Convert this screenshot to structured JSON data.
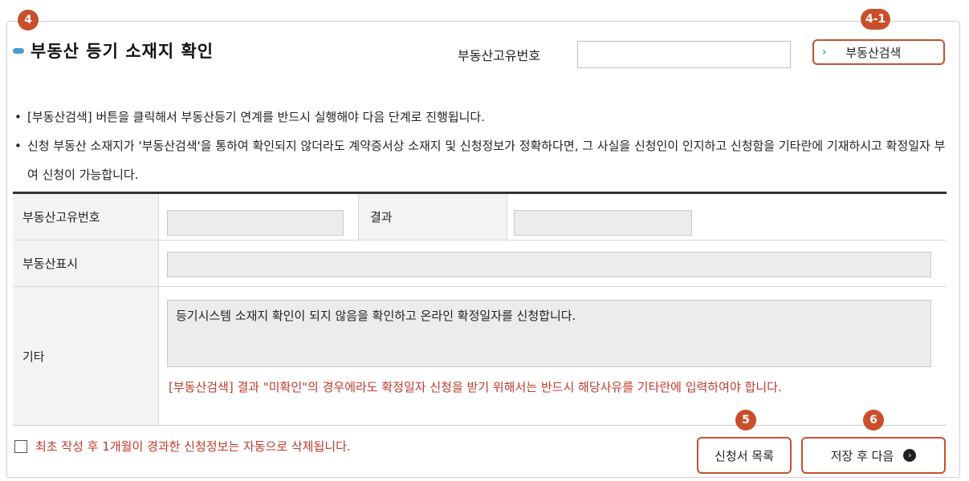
{
  "badges": {
    "step4": "4",
    "step4_1": "4-1",
    "step5": "5",
    "step6": "6"
  },
  "header": {
    "title": "부동산 등기 소재지 확인",
    "unique_no_label": "부동산고유번호",
    "unique_no_value": "",
    "search_button": "부동산검색",
    "search_chevron": "›"
  },
  "notes": [
    {
      "bullet": "•",
      "text": "[부동산검색] 버튼을 클릭해서 부동산등기 연계를 반드시 실행해야 다음 단계로 진행됩니다."
    },
    {
      "bullet": "•",
      "text": "신청 부동산 소재지가 '부동산검색'을 통하여 확인되지 않더라도 계약증서상 소재지 및 신청정보가 정확하다면, 그 사실을 신청인이 인지하고 신청함을 기타란에 기재하시고 확정일자 부여 신청이 가능합니다."
    }
  ],
  "table": {
    "row1_label": "부동산고유번호",
    "row1_value": "",
    "result_label": "결과",
    "result_value": "",
    "row2_label": "부동산표시",
    "row2_value": "",
    "row3_label": "기타",
    "etc_text": "등기시스템 소재지 확인이 되지 않음을 확인하고 온라인 확정일자를 신청합니다.",
    "warning": "[부동산검색] 결과 \"미확인\"의 경우에라도 확정일자 신청을 받기 위해서는 반드시 해당사유를 기타란에 입력하여야 합니다."
  },
  "footer": {
    "checkbox_label": "최초 작성 후 1개월이 경과한 신청정보는 자동으로 삭제됩니다.",
    "checkbox_checked": false,
    "list_button": "신청서 목록",
    "next_button": "저장 후 다음",
    "next_icon_glyph": "›"
  },
  "colors": {
    "accent": "#c94f2c",
    "warning": "#c0392b",
    "title_dot": "#4a9bd8"
  }
}
